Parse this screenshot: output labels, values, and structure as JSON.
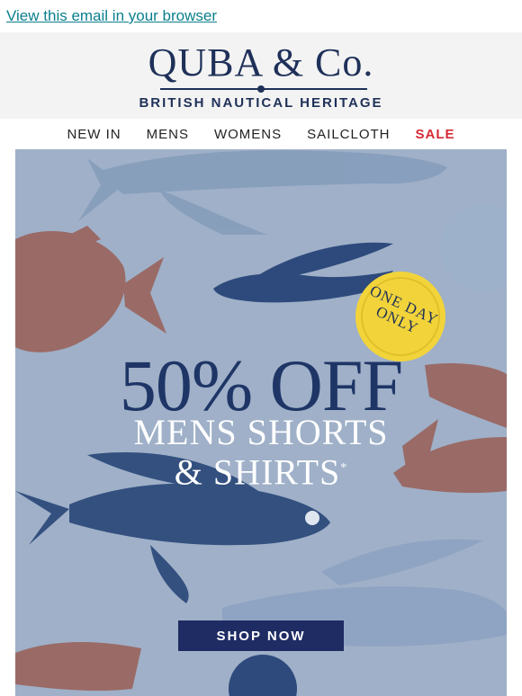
{
  "preheader": {
    "browser_link": "View this email in your browser"
  },
  "brand": {
    "logo_text": "QUBA & Co.",
    "tagline": "BRITISH NAUTICAL HERITAGE"
  },
  "nav": {
    "items": [
      {
        "label": "NEW IN"
      },
      {
        "label": "MENS"
      },
      {
        "label": "WOMENS"
      },
      {
        "label": "SAILCLOTH"
      },
      {
        "label": "SALE"
      }
    ]
  },
  "hero": {
    "badge": {
      "line1": "ONE DAY",
      "line2": "ONLY"
    },
    "headline": "50% OFF",
    "subline1": "MENS SHORTS",
    "subline2": "& SHIRTS",
    "footnote_mark": "*",
    "cta": "SHOP NOW",
    "colors": {
      "background": "#9fb0c8",
      "navy": "#1e3566",
      "rust": "#9a6a66",
      "badge": "#f2d43a"
    }
  }
}
